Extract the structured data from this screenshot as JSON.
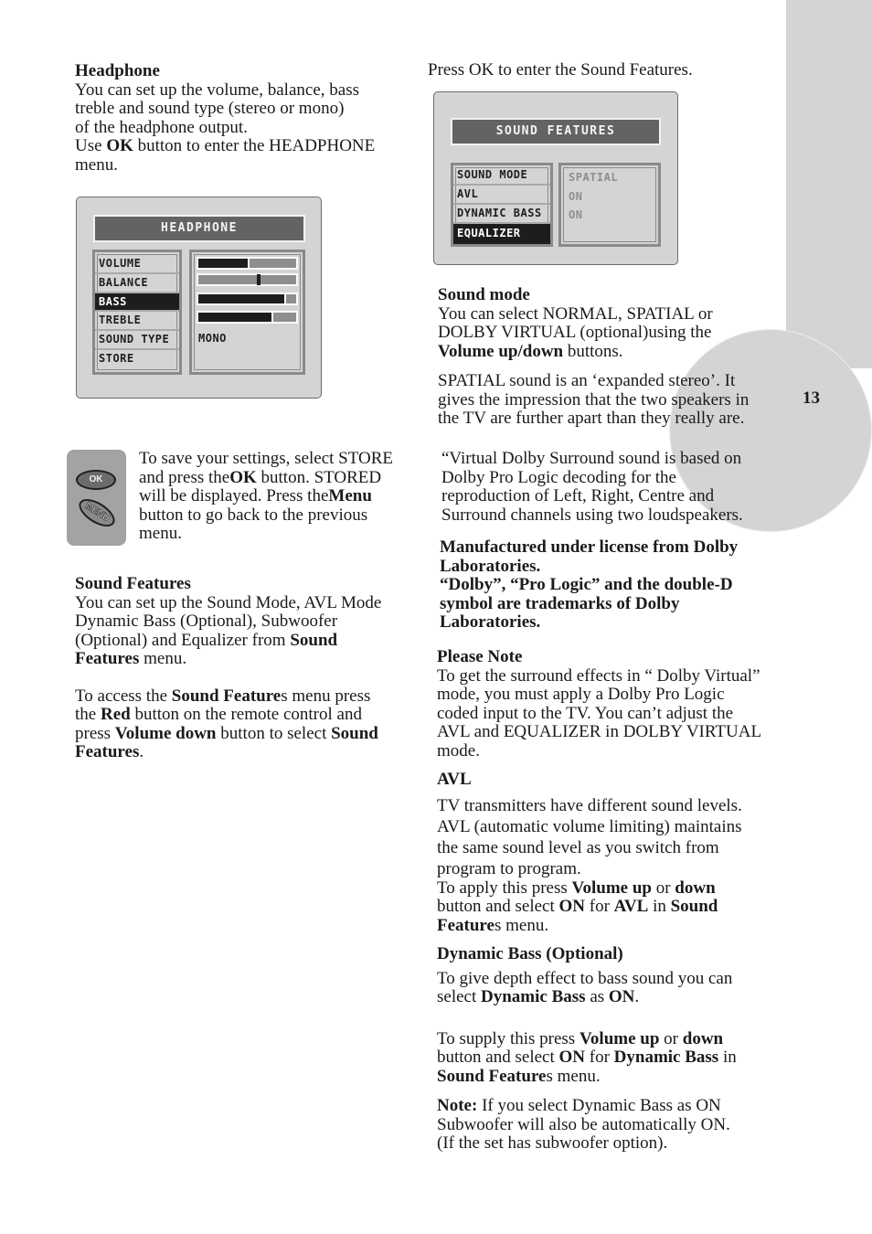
{
  "page_number": "13",
  "left_column": {
    "headphone": {
      "heading": "Headphone",
      "lines": [
        "You can set up the volume, balance, bass",
        "treble and sound type (stereo or mono)",
        "of the headphone output."
      ],
      "use_prefix": "Use ",
      "use_bold": "OK",
      "use_suffix": " button to enter the HEADPHONE",
      "use_last": "menu."
    },
    "store_note": {
      "l1": "To save your settings, select STORE",
      "l2_a": "and press the",
      "l2_b": "OK",
      "l2_c": " button. STORED",
      "l3_a": "will be displayed. Press the",
      "l3_b": "Menu",
      "l4": "button to go back to the previous",
      "l5": "menu."
    },
    "sound_features": {
      "heading": "Sound Features",
      "l1": "You can set up the Sound Mode,  AVL Mode",
      "l2": "Dynamic Bass (Optional), Subwoofer",
      "l3_a": "(Optional) and Equalizer from ",
      "l3_b": "Sound",
      "l4_a": "Features",
      "l4_b": " menu.",
      "access_l1_a": "To access the ",
      "access_l1_b": "Sound Feature",
      "access_l1_c": "s menu press",
      "access_l2_a": "the ",
      "access_l2_b": "Red",
      "access_l2_c": " button on the remote control and",
      "access_l3_a": "press ",
      "access_l3_b": "Volume down",
      "access_l3_c": " button to select ",
      "access_l3_d": "Sound",
      "access_l4_a": "Features",
      "access_l4_b": "."
    }
  },
  "remote_keys": {
    "ok": "OK",
    "menu": "MENU"
  },
  "headphone_menu": {
    "title": "HEADPHONE",
    "items": [
      "VOLUME",
      "BALANCE",
      "BASS",
      "TREBLE",
      "SOUND TYPE",
      "STORE"
    ],
    "selected_index": 2,
    "levels": {
      "volume": 0.5,
      "balance": 0.62,
      "bass": 0.88,
      "treble": 0.75
    },
    "sound_type_value": "MONO"
  },
  "sound_features_menu": {
    "intro": "Press OK to enter the Sound Features.",
    "title": "SOUND FEATURES",
    "items": [
      "SOUND MODE",
      "AVL",
      "DYNAMIC BASS",
      "EQUALIZER"
    ],
    "selected_index": 3,
    "values": [
      "SPATIAL",
      "ON",
      "ON"
    ]
  },
  "right_column": {
    "sound_mode": {
      "heading": "Sound mode",
      "l1": "You can select NORMAL, SPATIAL or",
      "l2": "DOLBY VIRTUAL (optional)using the",
      "l3_a": "Volume up/down",
      "l3_b": " buttons.",
      "spatial_l1": "SPATIAL sound is an ‘expanded stereo’.  It",
      "spatial_l2": "gives the impression that the two speakers in",
      "spatial_l3": "the TV are further apart than they really are."
    },
    "virtual_dolby": [
      "“Virtual Dolby Surround sound is based on",
      "Dolby Pro Logic decoding for the",
      "reproduction of Left, Right, Centre and",
      "Surround channels using two loudspeakers."
    ],
    "license": [
      "Manufactured under license from Dolby",
      "Laboratories.",
      "“Dolby”, “Pro Logic” and the double-D",
      "symbol are trademarks of Dolby",
      "Laboratories."
    ],
    "please_note": {
      "heading": "Please  Note",
      "lines": [
        "To get the surround effects in “ Dolby Virtual”",
        "mode, you must apply a Dolby Pro Logic",
        "coded input to the TV. You can’t  adjust the",
        "AVL and EQUALIZER in  DOLBY VIRTUAL",
        "mode."
      ]
    },
    "avl": {
      "heading": "AVL",
      "lines": [
        "TV transmitters have different sound levels.",
        "AVL (automatic volume limiting) maintains",
        "the same sound level as you switch from",
        "program to program."
      ],
      "apply_l1_a": "To apply this press ",
      "apply_l1_b": "Volume up",
      "apply_l1_c": " or ",
      "apply_l1_d": "down",
      "apply_l2_a": "button and select ",
      "apply_l2_b": "ON",
      "apply_l2_c": " for ",
      "apply_l2_d": "AVL",
      "apply_l2_e": " in ",
      "apply_l2_f": "Sound",
      "apply_l3_a": "Feature",
      "apply_l3_b": "s menu."
    },
    "dynamic_bass": {
      "heading": "Dynamic Bass (Optional)",
      "l1": "To give depth effect to bass sound you can",
      "l2_a": "select ",
      "l2_b": "Dynamic Bass",
      "l2_c": " as ",
      "l2_d": "ON",
      "l2_e": ".",
      "supply_l1_a": "To supply this press ",
      "supply_l1_b": "Volume up",
      "supply_l1_c": " or ",
      "supply_l1_d": "down",
      "supply_l2_a": "button and select ",
      "supply_l2_b": "ON",
      "supply_l2_c": " for ",
      "supply_l2_d": "Dynamic Bass",
      "supply_l2_e": " in",
      "supply_l3_a": "Sound Feature",
      "supply_l3_b": "s menu.",
      "note_a": "Note:",
      "note_b": " If you select Dynamic Bass as ON",
      "note_l2": "Subwoofer will also be automatically ON.",
      "note_l3": "(If the set has subwoofer option)."
    }
  }
}
